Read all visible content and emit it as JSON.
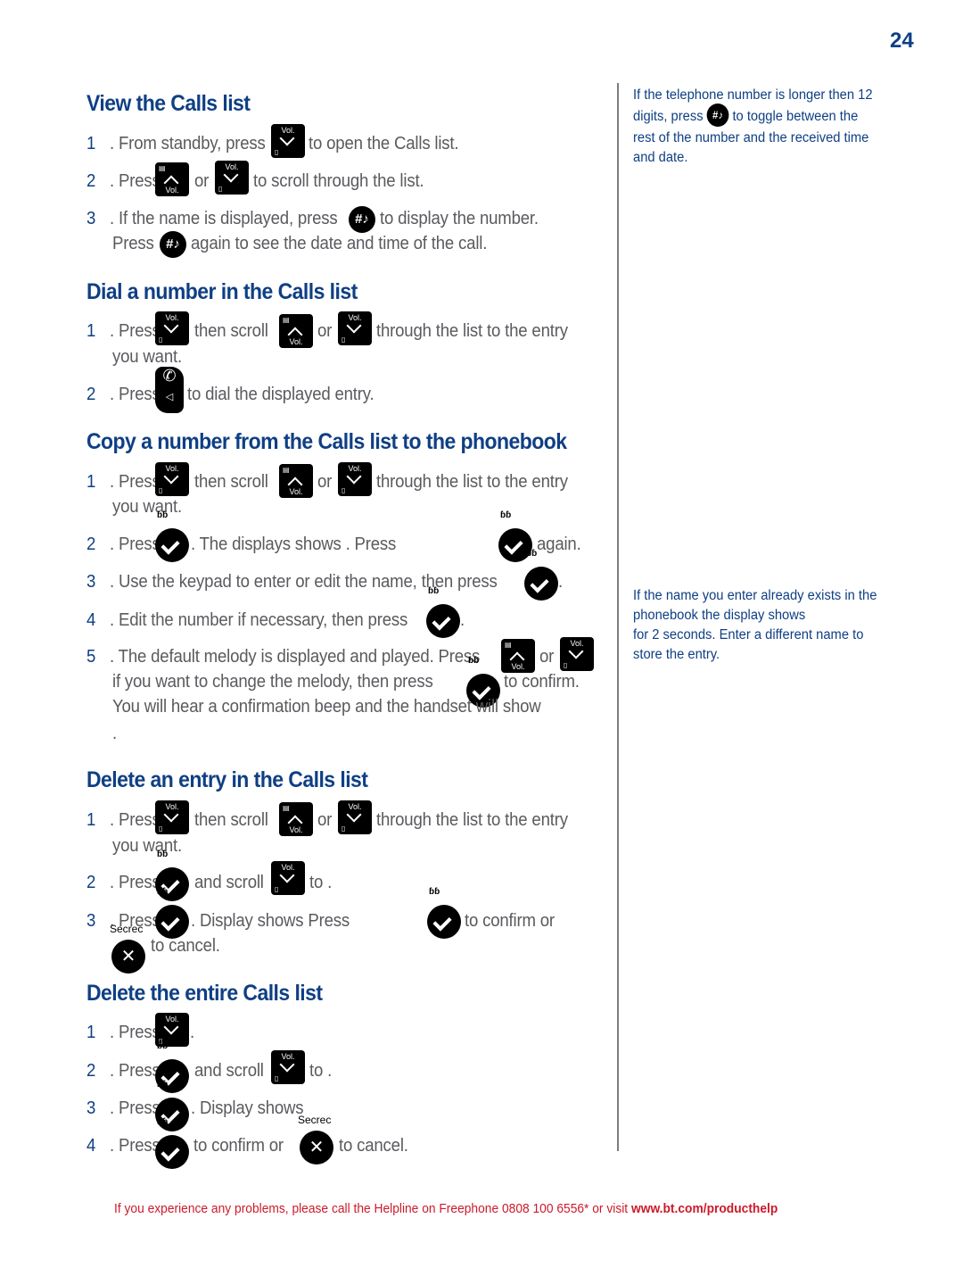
{
  "page_number": "24",
  "sections": {
    "view": {
      "title": "View the Calls list",
      "steps": [
        {
          "n": "1",
          "a": "From standby, press",
          "b": "to open the Calls list."
        },
        {
          "n": "2",
          "a": "Press",
          "or": "or",
          "b": "to scroll through the list."
        },
        {
          "n": "3",
          "a": "If the name is displayed, press",
          "b": "to display the number.",
          "c": "Press",
          "d": "again to see the date and time of the call."
        }
      ]
    },
    "dial": {
      "title": "Dial a number in the Calls list",
      "steps": [
        {
          "n": "1",
          "a": "Press",
          "b": "then scroll",
          "or": "or",
          "c": "through the list to the entry",
          "d": "you want."
        },
        {
          "n": "2",
          "a": "Press",
          "b": "to dial the displayed entry."
        }
      ]
    },
    "copy": {
      "title": "Copy a number from the Calls list to the phonebook",
      "steps": [
        {
          "n": "1",
          "a": "Press",
          "b": "then scroll",
          "or": "or",
          "c": "through the list to the entry",
          "d": "you want."
        },
        {
          "n": "2",
          "a": "Press",
          "b": ". The displays shows . Press",
          "c": "again."
        },
        {
          "n": "3",
          "a": "Use the keypad to enter or edit the name, then press",
          "b": "."
        },
        {
          "n": "4",
          "a": "Edit the number if necessary, then press",
          "b": "."
        },
        {
          "n": "5",
          "a": "The default melody is displayed and played. Press",
          "or": "or",
          "b": "if you want to change the melody, then press",
          "c": "to confirm.",
          "d": "You will hear a confirmation beep and the handset will show",
          "e": "."
        }
      ]
    },
    "delete_entry": {
      "title": "Delete an entry in the Calls list",
      "steps": [
        {
          "n": "1",
          "a": "Press",
          "b": "then scroll",
          "or": "or",
          "c": "through the list to the entry",
          "d": "you want."
        },
        {
          "n": "2",
          "a": "Press",
          "b": "and scroll",
          "c": "to  ."
        },
        {
          "n": "3",
          "a": "Press",
          "b": ". Display shows  Press",
          "c": "to confirm or",
          "d": "to cancel."
        }
      ]
    },
    "delete_all": {
      "title": "Delete the entire Calls list",
      "steps": [
        {
          "n": "1",
          "a": "Press",
          "b": "."
        },
        {
          "n": "2",
          "a": "Press",
          "b": "and scroll",
          "c": "to  ."
        },
        {
          "n": "3",
          "a": "Press",
          "b": ". Display shows"
        },
        {
          "n": "4",
          "a": "Press",
          "b": "to confirm or",
          "c": "to cancel."
        }
      ]
    }
  },
  "keys": {
    "vol": "Vol.",
    "hash": "#♪",
    "menu_mark": "ɓɓ",
    "secrecy": "Secrec"
  },
  "notes": {
    "long_number": "If the telephone number is longer then 12 digits, press",
    "long_number_b": "to toggle between the rest of the number and the received time and date.",
    "name_exists": "If the name you enter already exists in the phonebook the display shows",
    "name_exists_b": "for 2 seconds. Enter a different name to store the entry."
  },
  "footer": {
    "text": "If you experience any problems, please call the Helpline on Freephone 0808 100 6556* or visit",
    "link": "www.bt.com/producthelp"
  }
}
